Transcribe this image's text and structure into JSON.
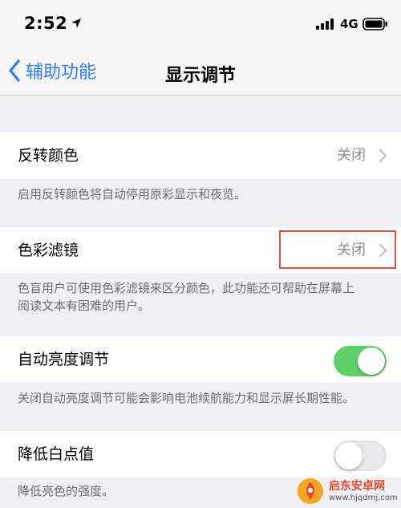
{
  "status": {
    "time": "2:52",
    "network": "4G"
  },
  "nav": {
    "back_label": "辅助功能",
    "title": "显示调节"
  },
  "invert": {
    "label": "反转颜色",
    "value": "关闭",
    "description": "启用反转颜色将自动停用原彩显示和夜览。"
  },
  "color_filter": {
    "label": "色彩滤镜",
    "value": "关闭",
    "description_line1": "色盲用户可使用色彩滤镜来区分颜色，此功能还可帮助在屏幕上",
    "description_line2": "阅读文本有困难的用户。"
  },
  "auto_brightness": {
    "label": "自动亮度调节",
    "state": "on",
    "description": "关闭自动亮度调节可能会影响电池续航能力和显示屏长期性能。"
  },
  "reduce_white_point": {
    "label": "降低白点值",
    "state": "off",
    "description": "降低亮色的强度。"
  },
  "watermark": {
    "title": "启东安卓网",
    "url": "www.hjqdmj.com"
  },
  "colors": {
    "accent": "#2f7cf6",
    "toggle_on": "#5fd068",
    "highlight": "#d9534f"
  }
}
